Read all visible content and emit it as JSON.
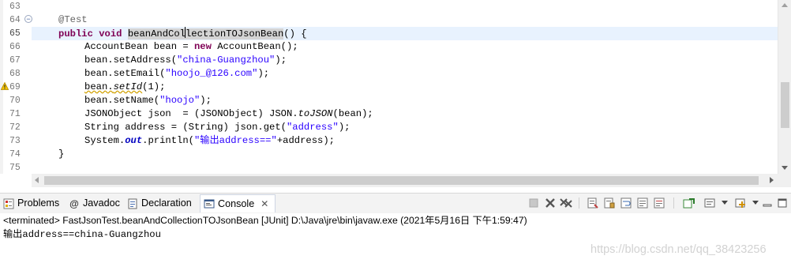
{
  "editor": {
    "line_numbers": [
      "63",
      "64",
      "65",
      "66",
      "67",
      "68",
      "69",
      "70",
      "71",
      "72",
      "73",
      "74",
      "75"
    ],
    "lines": {
      "l64": {
        "annotation": "@Test"
      },
      "l65": {
        "kw_public": "public",
        "kw_void": "void",
        "method_part1": "beanAndCol",
        "method_part2": "lectionTOJsonBean",
        "rest": "() {"
      },
      "l66": {
        "t1": "AccountBean bean = ",
        "kw_new": "new",
        "t2": " AccountBean();"
      },
      "l67": {
        "t1": "bean.setAddress(",
        "str": "\"china-Guangzhou\"",
        "t2": ");"
      },
      "l68": {
        "t1": "bean.setEmail(",
        "str": "\"hoojo_@126.com\"",
        "t2": ");"
      },
      "l69": {
        "t1": "bean.",
        "method": "setId",
        "t2": "(1);"
      },
      "l70": {
        "t1": "bean.setName(",
        "str": "\"hoojo\"",
        "t2": ");"
      },
      "l71": {
        "t1": "JSONObject json  = (JSONObject) JSON.",
        "method": "toJSON",
        "t2": "(bean);"
      },
      "l72": {
        "t1": "String address = (String) json.get(",
        "str": "\"address\"",
        "t2": ");"
      },
      "l73": {
        "t1": "System.",
        "field": "out",
        "t2": ".println(",
        "str": "\"输出address==\"",
        "t3": "+address);"
      },
      "l74": {
        "t1": "}"
      }
    }
  },
  "views": {
    "tabs": [
      {
        "label": "Problems",
        "icon": "problems-icon"
      },
      {
        "label": "Javadoc",
        "icon": "javadoc-icon"
      },
      {
        "label": "Declaration",
        "icon": "declaration-icon"
      },
      {
        "label": "Console",
        "icon": "console-icon",
        "active": true
      }
    ],
    "close_glyph": "✕"
  },
  "console": {
    "terminated_line": "<terminated> FastJsonTest.beanAndCollectionTOJsonBean [JUnit] D:\\Java\\jre\\bin\\javaw.exe (2021年5月16日 下午1:59:47)",
    "output_line": "输出address==china-Guangzhou"
  },
  "watermark": "https://blog.csdn.net/qq_38423256",
  "colors": {
    "keyword": "#7f0055",
    "string": "#2a00ff",
    "current_line": "#e8f2fe"
  }
}
